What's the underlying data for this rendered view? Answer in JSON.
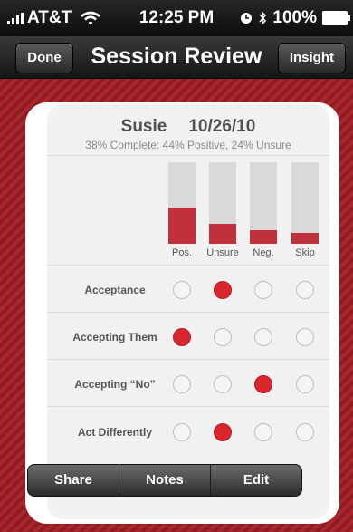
{
  "status": {
    "carrier": "AT&T",
    "time": "12:25 PM",
    "battery": "100%"
  },
  "nav": {
    "left_button": "Done",
    "title": "Session Review",
    "right_button": "Insight"
  },
  "session": {
    "name": "Susie",
    "date": "10/26/10",
    "summary": "38% Complete: 44% Positive, 24% Unsure"
  },
  "columns": [
    {
      "label": "Pos.",
      "fill": 0.44
    },
    {
      "label": "Unsure",
      "fill": 0.24
    },
    {
      "label": "Neg.",
      "fill": 0.17
    },
    {
      "label": "Skip",
      "fill": 0.13
    }
  ],
  "rows": [
    {
      "label": "Acceptance",
      "selected": 1
    },
    {
      "label": "Accepting Them",
      "selected": 0
    },
    {
      "label": "Accepting “No”",
      "selected": 2
    },
    {
      "label": "Act Differently",
      "selected": 1
    }
  ],
  "toolbar": {
    "share": "Share",
    "notes": "Notes",
    "edit": "Edit"
  },
  "colors": {
    "accent": "#d9262c",
    "bar_fill": "#c0303d",
    "background_stripe": "#a8262c"
  }
}
